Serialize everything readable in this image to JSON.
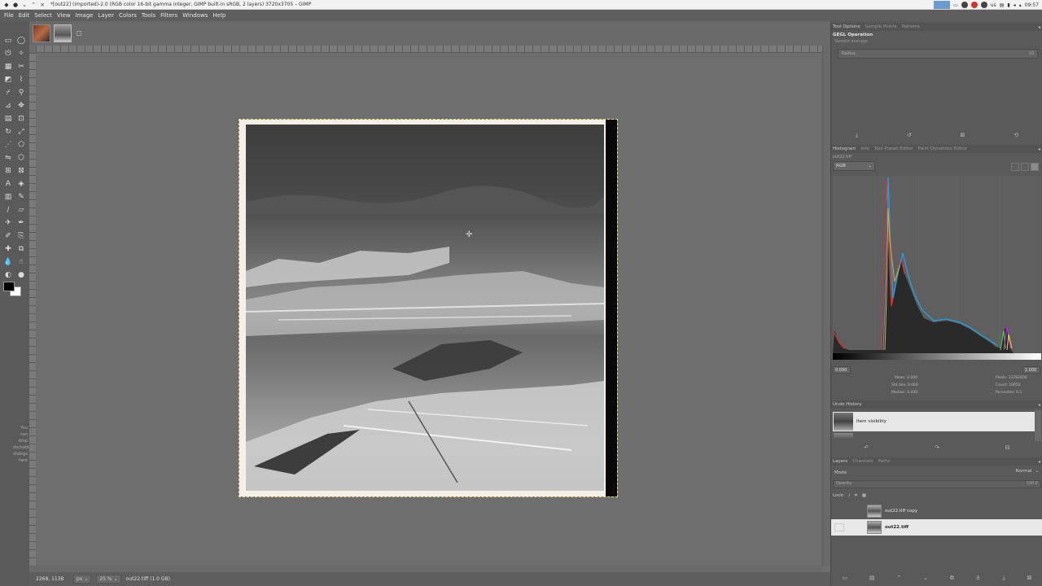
{
  "window": {
    "title": "*[out22] (imported)-2.0 (RGB color 16-bit gamma integer, GIMP built-in sRGB, 2 layers) 3720x3705 – GIMP"
  },
  "tray": {
    "locale": "us",
    "time": "09:57"
  },
  "menubar": {
    "items": [
      "File",
      "Edit",
      "Select",
      "View",
      "Image",
      "Layer",
      "Colors",
      "Tools",
      "Filters",
      "Windows",
      "Help"
    ]
  },
  "toolbox": {
    "dock_hint": "You can drop dockable dialogs here"
  },
  "statusbar": {
    "coords": "2268, 1138",
    "unit": "px",
    "zoom": "25 %",
    "info": "out22.tiff (1.0 GB)"
  },
  "dock": {
    "tool_options_tabs": [
      "Tool Options",
      "Sample Points",
      "Patterns"
    ],
    "gegl_title": "GEGL Operation",
    "gegl_subtitle": "Sample average",
    "radius_label": "Radius",
    "radius_value": "10",
    "histogram_tabs": [
      "Histogram",
      "Info",
      "Tool Preset Editor",
      "Paint Dynamics Editor"
    ],
    "histogram_layer": "out22.tiff",
    "histogram_channel": "RGB",
    "histogram_min": "0.000",
    "histogram_max": "1.000",
    "stats_left": {
      "mean": "Mean: 0.000",
      "stddev": "Std dev: 0.000",
      "median": "Median: 0.000"
    },
    "stats_right": {
      "pixels": "Pixels: 13782600",
      "count": "Count: 19050",
      "percentile": "Percentile: 0.1"
    },
    "undo_tab": "Undo History",
    "undo_item": "Item visibility",
    "layers_tabs": [
      "Layers",
      "Channels",
      "Paths"
    ],
    "mode_label": "Mode",
    "mode_value": "Normal",
    "opacity_label": "Opacity",
    "opacity_value": "100.0",
    "lock_label": "Lock:",
    "layers": [
      "out22.tiff copy",
      "out22.tiff"
    ]
  },
  "icons": {
    "crosshair": "crosshair-cursor-icon"
  }
}
